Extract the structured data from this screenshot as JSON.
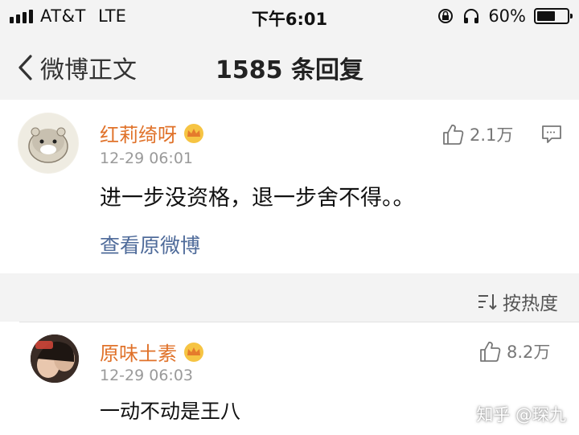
{
  "status_bar": {
    "carrier": "AT&T",
    "network": "LTE",
    "time": "下午6:01",
    "battery": "60%",
    "battery_level": 0.6
  },
  "nav": {
    "back_label": "微博正文",
    "title": "1585 条回复"
  },
  "post": {
    "username": "红莉绮呀",
    "timestamp": "12-29 06:01",
    "content": "进一步没资格，退一步舍不得。。",
    "likes": "2.1万",
    "view_original": "查看原微博"
  },
  "sort": {
    "label": "按热度"
  },
  "reply": {
    "username": "原味土素",
    "timestamp": "12-29 06:03",
    "content": "一动不动是王八",
    "likes": "8.2万"
  },
  "watermark": "知乎 @琛九",
  "icons": {
    "signal": "signal-bars-icon",
    "rotation_lock": "rotation-lock-icon",
    "headphones": "headphones-icon",
    "battery": "battery-icon",
    "back": "chevron-left-icon",
    "crown": "crown-badge-icon",
    "thumb": "thumbs-up-icon",
    "comment": "comment-icon",
    "sort": "sort-icon"
  },
  "colors": {
    "username": "#e0722a",
    "link": "#4f6b9a"
  }
}
